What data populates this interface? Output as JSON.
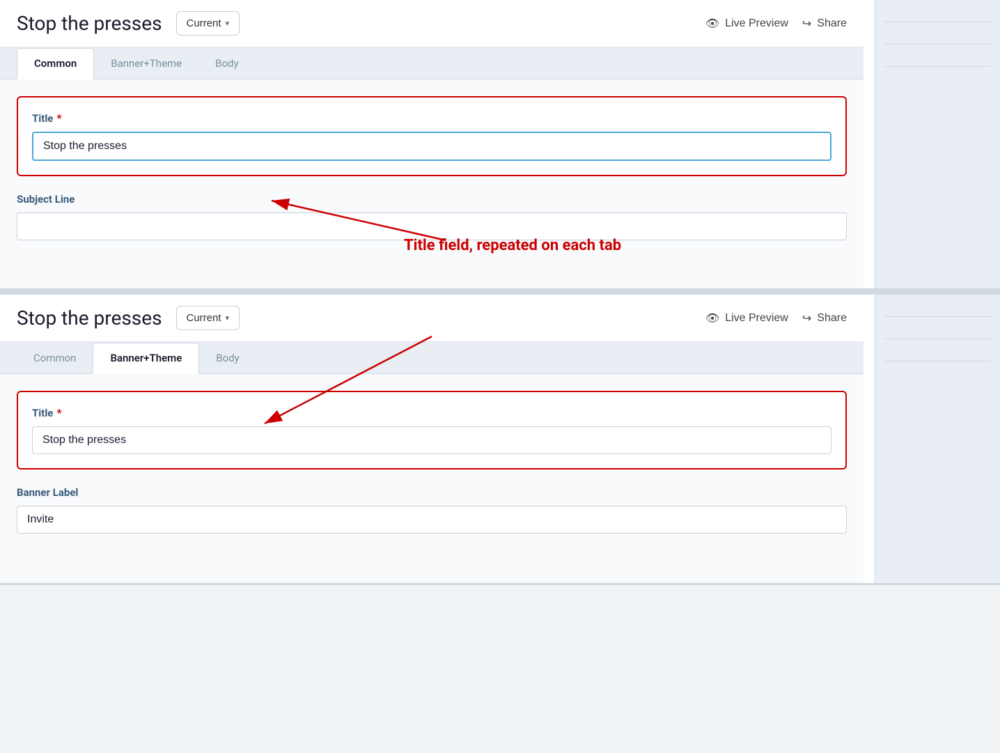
{
  "page": {
    "title": "Stop the presses"
  },
  "header1": {
    "title": "Stop the presses",
    "dropdown_label": "Current",
    "chevron": "▾",
    "live_preview_label": "Live Preview",
    "share_label": "Share"
  },
  "header2": {
    "title": "Stop the presses",
    "dropdown_label": "Current",
    "chevron": "▾",
    "live_preview_label": "Live Preview",
    "share_label": "Share"
  },
  "tabs1": {
    "items": [
      {
        "id": "common",
        "label": "Common",
        "active": true
      },
      {
        "id": "banner-theme",
        "label": "Banner+Theme",
        "active": false
      },
      {
        "id": "body",
        "label": "Body",
        "active": false
      }
    ]
  },
  "tabs2": {
    "items": [
      {
        "id": "common",
        "label": "Common",
        "active": false
      },
      {
        "id": "banner-theme",
        "label": "Banner+Theme",
        "active": true
      },
      {
        "id": "body",
        "label": "Body",
        "active": false
      }
    ]
  },
  "form1": {
    "title_label": "Title",
    "title_value": "Stop the presses",
    "title_placeholder": "Stop the presses",
    "subject_line_label": "Subject Line",
    "subject_line_value": "",
    "subject_line_placeholder": ""
  },
  "form2": {
    "title_label": "Title",
    "title_value": "Stop the presses",
    "title_placeholder": "Stop the presses",
    "banner_label_label": "Banner Label",
    "banner_label_value": "Invite",
    "banner_label_placeholder": "Invite"
  },
  "annotation": {
    "text": "Title field, repeated on each tab"
  },
  "icons": {
    "eye": "👁",
    "share": "↪"
  }
}
